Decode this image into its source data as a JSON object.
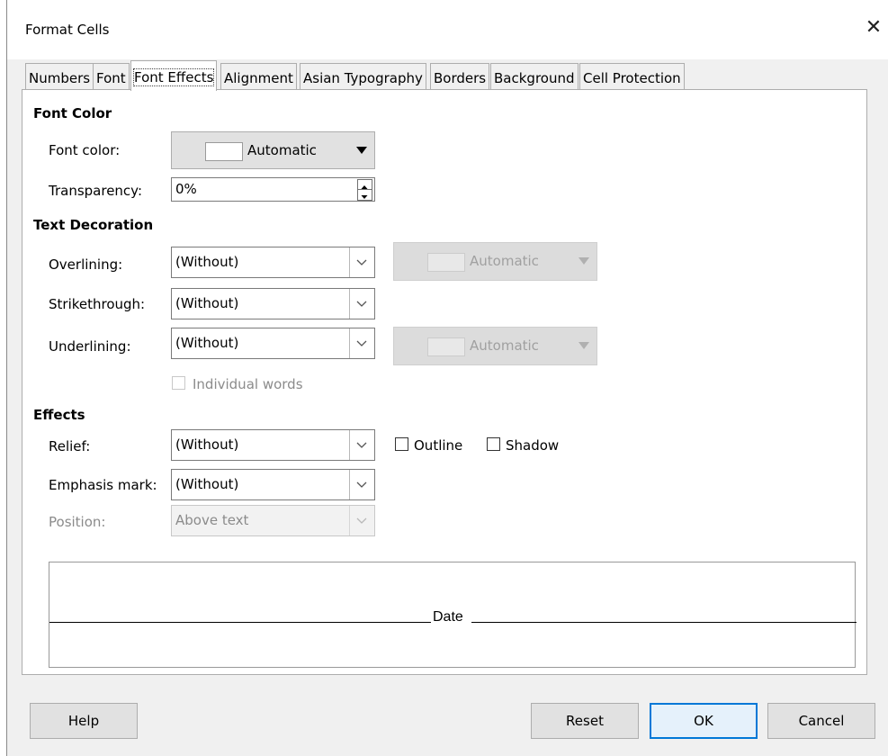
{
  "dialog": {
    "title": "Format Cells",
    "close_glyph": "✕"
  },
  "tabs": [
    {
      "label": "Numbers"
    },
    {
      "label": "Font"
    },
    {
      "label": "Font Effects"
    },
    {
      "label": "Alignment"
    },
    {
      "label": "Asian Typography"
    },
    {
      "label": "Borders"
    },
    {
      "label": "Background"
    },
    {
      "label": "Cell Protection"
    }
  ],
  "active_tab": "Font Effects",
  "font_color": {
    "heading": "Font Color",
    "label": "Font color:",
    "value": "Automatic",
    "transparency_label": "Transparency:",
    "transparency_value": "0%"
  },
  "text_decoration": {
    "heading": "Text Decoration",
    "overlining_label": "Overlining:",
    "overlining_value": "(Without)",
    "overline_color": "Automatic",
    "strikethrough_label": "Strikethrough:",
    "strikethrough_value": "(Without)",
    "underlining_label": "Underlining:",
    "underlining_value": "(Without)",
    "underline_color": "Automatic",
    "individual_words_label": "Individual words",
    "individual_words_checked": false
  },
  "effects": {
    "heading": "Effects",
    "relief_label": "Relief:",
    "relief_value": "(Without)",
    "outline_label": "Outline",
    "outline_checked": false,
    "shadow_label": "Shadow",
    "shadow_checked": false,
    "emphasis_label": "Emphasis mark:",
    "emphasis_value": "(Without)",
    "position_label": "Position:",
    "position_value": "Above text"
  },
  "preview": {
    "text": "Date"
  },
  "buttons": {
    "help": "Help",
    "reset": "Reset",
    "ok": "OK",
    "cancel": "Cancel"
  },
  "colors": {
    "accent": "#0078d7",
    "panel": "#ffffff",
    "dialog_bg": "#f0f0f0",
    "disabled_text": "#8b8b8b"
  },
  "icons": {
    "dropdown": "chevron-down-icon",
    "spinner": "spinner-arrows-icon",
    "close": "close-icon"
  }
}
